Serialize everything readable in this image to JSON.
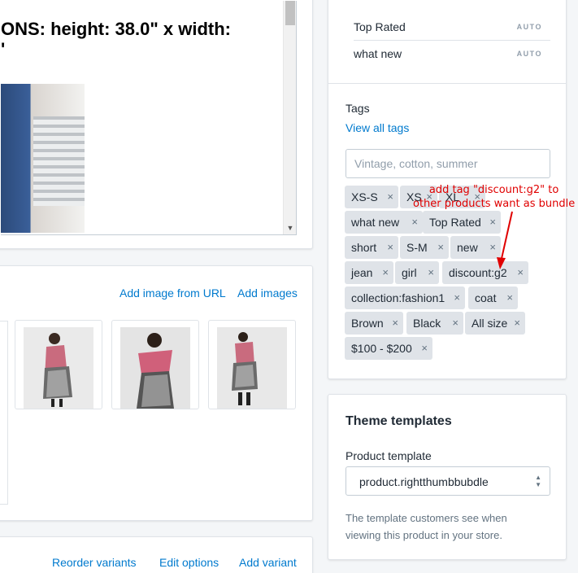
{
  "description": {
    "heading_line1": "ONS: height: 38.0\" x width:",
    "heading_line2": "'"
  },
  "images": {
    "add_from_url": "Add image from URL",
    "add_images": "Add images"
  },
  "variants": {
    "reorder": "Reorder variants",
    "edit_options": "Edit options",
    "add_variant": "Add variant"
  },
  "collections": [
    {
      "label": "Top Rated",
      "badge": "AUTO"
    },
    {
      "label": "what new",
      "badge": "AUTO"
    }
  ],
  "tags": {
    "title": "Tags",
    "view_all": "View all tags",
    "input_placeholder": "Vintage, cotton, summer",
    "items": [
      "XS-S",
      "XS",
      "XL",
      "what new",
      "Top Rated",
      "short",
      "S-M",
      "new",
      "jean",
      "girl",
      "discount:g2",
      "collection:fashion1",
      "coat",
      "Brown",
      "Black",
      "All size",
      "$100 - $200"
    ],
    "remove_glyph": "×"
  },
  "annotation": {
    "line1": "add tag \"discount:g2\" to",
    "line2": "other products want as bundle",
    "color": "#e00000"
  },
  "theme": {
    "title": "Theme templates",
    "product_template_label": "Product template",
    "selected_template": "product.rightthumbbubdle",
    "help_line1": "The template customers see when",
    "help_line2": "viewing this product in your store."
  },
  "colors": {
    "link": "#007ace",
    "background": "#f4f6f8",
    "tag_bg": "#dfe3e8"
  }
}
